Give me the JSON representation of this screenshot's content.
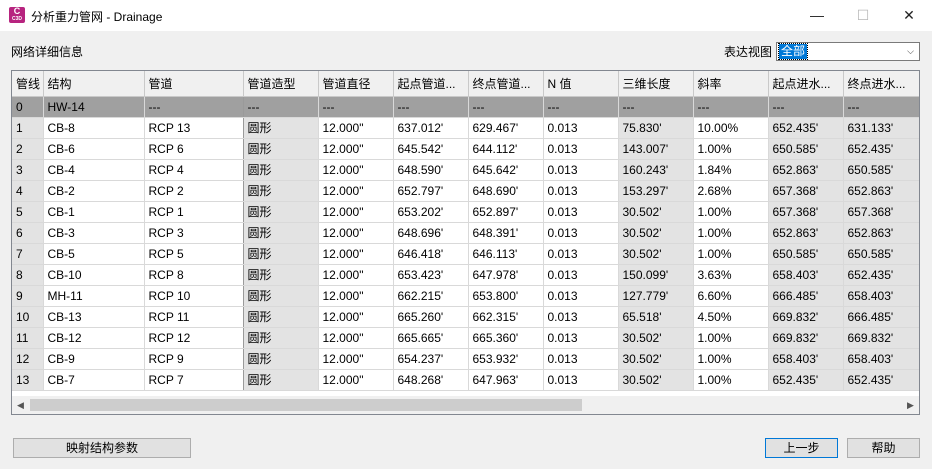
{
  "window": {
    "icon_letter": "C",
    "icon_sub": "C3D",
    "title": "分析重力管网 - Drainage",
    "minimize": "—",
    "maximize": "☐",
    "close": "✕"
  },
  "section_label": "网络详细信息",
  "view": {
    "label": "表达视图",
    "selected": "全部"
  },
  "columns": [
    "管线",
    "结构",
    "管道",
    "管道造型",
    "管道直径",
    "起点管道...",
    "终点管道...",
    "N 值",
    "三维长度",
    "斜率",
    "起点进水...",
    "终点进水..."
  ],
  "rows": [
    [
      "0",
      "HW-14",
      "---",
      "---",
      "---",
      "---",
      "---",
      "---",
      "---",
      "---",
      "---",
      "---"
    ],
    [
      "1",
      "CB-8",
      "RCP 13",
      "圆形",
      "12.000\"",
      "637.012'",
      "629.467'",
      "0.013",
      "75.830'",
      "10.00%",
      "652.435'",
      "631.133'"
    ],
    [
      "2",
      "CB-6",
      "RCP 6",
      "圆形",
      "12.000\"",
      "645.542'",
      "644.112'",
      "0.013",
      "143.007'",
      "1.00%",
      "650.585'",
      "652.435'"
    ],
    [
      "3",
      "CB-4",
      "RCP 4",
      "圆形",
      "12.000\"",
      "648.590'",
      "645.642'",
      "0.013",
      "160.243'",
      "1.84%",
      "652.863'",
      "650.585'"
    ],
    [
      "4",
      "CB-2",
      "RCP 2",
      "圆形",
      "12.000\"",
      "652.797'",
      "648.690'",
      "0.013",
      "153.297'",
      "2.68%",
      "657.368'",
      "652.863'"
    ],
    [
      "5",
      "CB-1",
      "RCP 1",
      "圆形",
      "12.000\"",
      "653.202'",
      "652.897'",
      "0.013",
      "30.502'",
      "1.00%",
      "657.368'",
      "657.368'"
    ],
    [
      "6",
      "CB-3",
      "RCP 3",
      "圆形",
      "12.000\"",
      "648.696'",
      "648.391'",
      "0.013",
      "30.502'",
      "1.00%",
      "652.863'",
      "652.863'"
    ],
    [
      "7",
      "CB-5",
      "RCP 5",
      "圆形",
      "12.000\"",
      "646.418'",
      "646.113'",
      "0.013",
      "30.502'",
      "1.00%",
      "650.585'",
      "650.585'"
    ],
    [
      "8",
      "CB-10",
      "RCP 8",
      "圆形",
      "12.000\"",
      "653.423'",
      "647.978'",
      "0.013",
      "150.099'",
      "3.63%",
      "658.403'",
      "652.435'"
    ],
    [
      "9",
      "MH-11",
      "RCP 10",
      "圆形",
      "12.000\"",
      "662.215'",
      "653.800'",
      "0.013",
      "127.779'",
      "6.60%",
      "666.485'",
      "658.403'"
    ],
    [
      "10",
      "CB-13",
      "RCP 11",
      "圆形",
      "12.000\"",
      "665.260'",
      "662.315'",
      "0.013",
      "65.518'",
      "4.50%",
      "669.832'",
      "666.485'"
    ],
    [
      "11",
      "CB-12",
      "RCP 12",
      "圆形",
      "12.000\"",
      "665.665'",
      "665.360'",
      "0.013",
      "30.502'",
      "1.00%",
      "669.832'",
      "669.832'"
    ],
    [
      "12",
      "CB-9",
      "RCP 9",
      "圆形",
      "12.000\"",
      "654.237'",
      "653.932'",
      "0.013",
      "30.502'",
      "1.00%",
      "658.403'",
      "658.403'"
    ],
    [
      "13",
      "CB-7",
      "RCP 7",
      "圆形",
      "12.000\"",
      "648.268'",
      "647.963'",
      "0.013",
      "30.502'",
      "1.00%",
      "652.435'",
      "652.435'"
    ]
  ],
  "buttons": {
    "map": "映射结构参数",
    "prev": "上一步",
    "help": "帮助"
  },
  "colors": {
    "selected_row": "#a0a0a0",
    "readonly_cell": "#e3e3e3",
    "accent": "#0078d7",
    "app_icon": "#b7247f"
  }
}
